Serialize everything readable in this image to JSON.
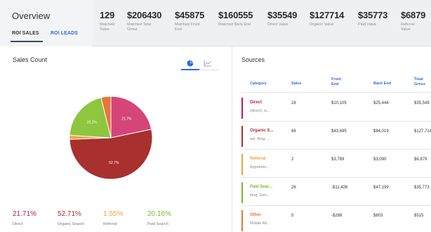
{
  "header": {
    "title": "Overview",
    "tabs": [
      {
        "label": "ROI SALES",
        "active": true
      },
      {
        "label": "ROI LEADS",
        "active": false
      }
    ]
  },
  "stats": [
    {
      "value": "129",
      "label": "Matched Sales"
    },
    {
      "value": "$206430",
      "label": "Matched Total Gross"
    },
    {
      "value": "$45875",
      "label": "Matched Front End"
    },
    {
      "value": "$160555",
      "label": "Matched Back End"
    },
    {
      "value": "$35549",
      "label": "Direct Value"
    },
    {
      "value": "$127714",
      "label": "Organic Value"
    },
    {
      "value": "$35773",
      "label": "Paid Value"
    },
    {
      "value": "$6879",
      "label": "Referral Value"
    }
  ],
  "sales_count": {
    "title": "Sales Count",
    "view_icons": [
      "pie-chart-icon",
      "line-chart-icon"
    ],
    "pie": [
      {
        "name": "Direct",
        "percent": 21.7,
        "label": "21.7%",
        "color": "#d6457a"
      },
      {
        "name": "Organic Search",
        "percent": 52.7,
        "label": "52.7%",
        "color": "#a8302e"
      },
      {
        "name": "Referral",
        "percent": 1.55,
        "label": "",
        "color": "#f2a03d"
      },
      {
        "name": "Paid Search",
        "percent": 20.2,
        "label": "20.2%",
        "color": "#8ec63f"
      },
      {
        "name": "Other",
        "percent": 3.85,
        "label": "",
        "color": "#e8763a"
      }
    ],
    "legend": [
      {
        "value": "21.71%",
        "label": "Direct",
        "color": "#c2185b"
      },
      {
        "value": "52.71%",
        "label": "Organic Search",
        "color": "#a8302e"
      },
      {
        "value": "1.55%",
        "label": "Referral",
        "color": "#f2a03d"
      },
      {
        "value": "20.16%",
        "label": "Paid Search",
        "color": "#7cb82f"
      }
    ]
  },
  "sources": {
    "title": "Sources",
    "columns": [
      "Category",
      "Sales",
      "Front End",
      "Back End",
      "Total Gross"
    ],
    "rows": [
      {
        "category": "Direct",
        "sub": "(direct), w...",
        "sales": "28",
        "front": "$10,105",
        "back": "$25,444",
        "total": "$35,549",
        "color": "#c2185b"
      },
      {
        "category": "Organic S...",
        "sub": "aol, Bing, ...",
        "sales": "68",
        "front": "$43,695",
        "back": "$84,019",
        "total": "$127,714",
        "color": "#a8302e"
      },
      {
        "category": "Referral",
        "sub": "Appointm...",
        "sales": "2",
        "front": "$3,789",
        "back": "$3,090",
        "total": "$6,879",
        "color": "#f2a03d"
      },
      {
        "category": "Paid Sear...",
        "sub": "bing, Gen...",
        "sales": "26",
        "front": "-$11,426",
        "back": "$47,199",
        "total": "$35,773",
        "color": "#7cb82f"
      },
      {
        "category": "Other",
        "sub": "Mobile Aft...",
        "sales": "5",
        "front": "-$288",
        "back": "$803",
        "total": "$515",
        "color": "#e8763a"
      }
    ]
  }
}
